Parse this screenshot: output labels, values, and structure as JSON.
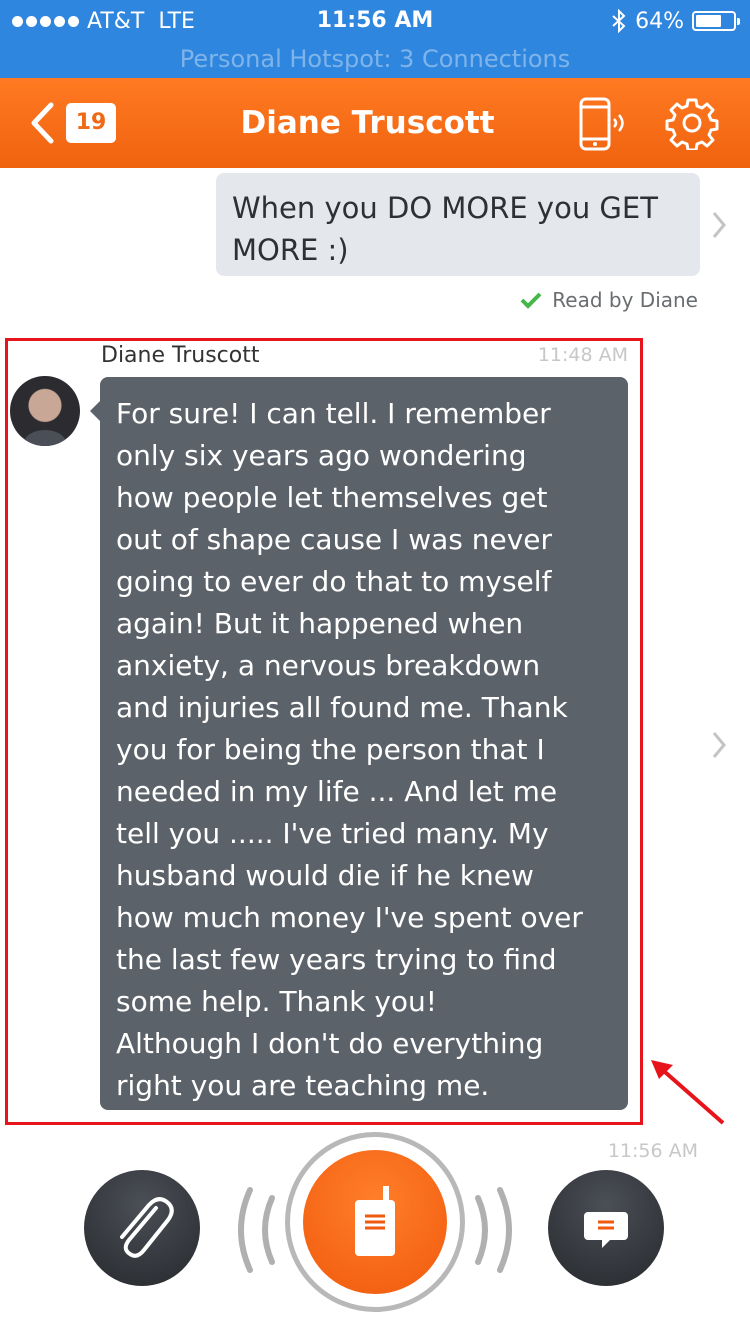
{
  "status_bar": {
    "carrier": "AT&T",
    "network": "LTE",
    "time": "11:56 AM",
    "battery": "64%",
    "battery_level": 0.64,
    "hotspot": "Personal Hotspot: 3 Connections"
  },
  "nav": {
    "badge_count": "19",
    "title": "Diane Truscott",
    "icons": [
      "back-chevron-icon",
      "walkie-phone-icon",
      "gear-icon"
    ]
  },
  "conversation": {
    "outgoing_message": "When you DO MORE you GET MORE :)",
    "read_receipt": "Read by Diane",
    "incoming": {
      "sender": "Diane Truscott",
      "time": "11:48 AM",
      "lines": [
        "For sure!  I can tell.  I remember",
        "only six years ago wondering",
        "how people let themselves get",
        "out of shape cause I was never",
        "going to ever do that to myself",
        "again!   But it happened when",
        "anxiety, a nervous breakdown",
        "and injuries all found me.  Thank",
        "you for being the person that I",
        "needed in my life ... And let me",
        "tell you ..... I've tried many.   My",
        "husband would die if he knew",
        "how much money I've spent over",
        "the last few years trying to find",
        "some help.  Thank you!",
        "Although I don't do everything",
        "right you are teaching me."
      ]
    },
    "next_time": "11:56 AM"
  },
  "controls": {
    "icons": [
      "paperclip-icon",
      "walkie-talkie-icon",
      "text-message-icon"
    ]
  },
  "colors": {
    "status_bar": "#2f86de",
    "nav_bar": "#f26a16",
    "incoming_bubble": "#5c6269",
    "outgoing_bubble": "#e4e8ed",
    "highlight": "#e8141c"
  }
}
